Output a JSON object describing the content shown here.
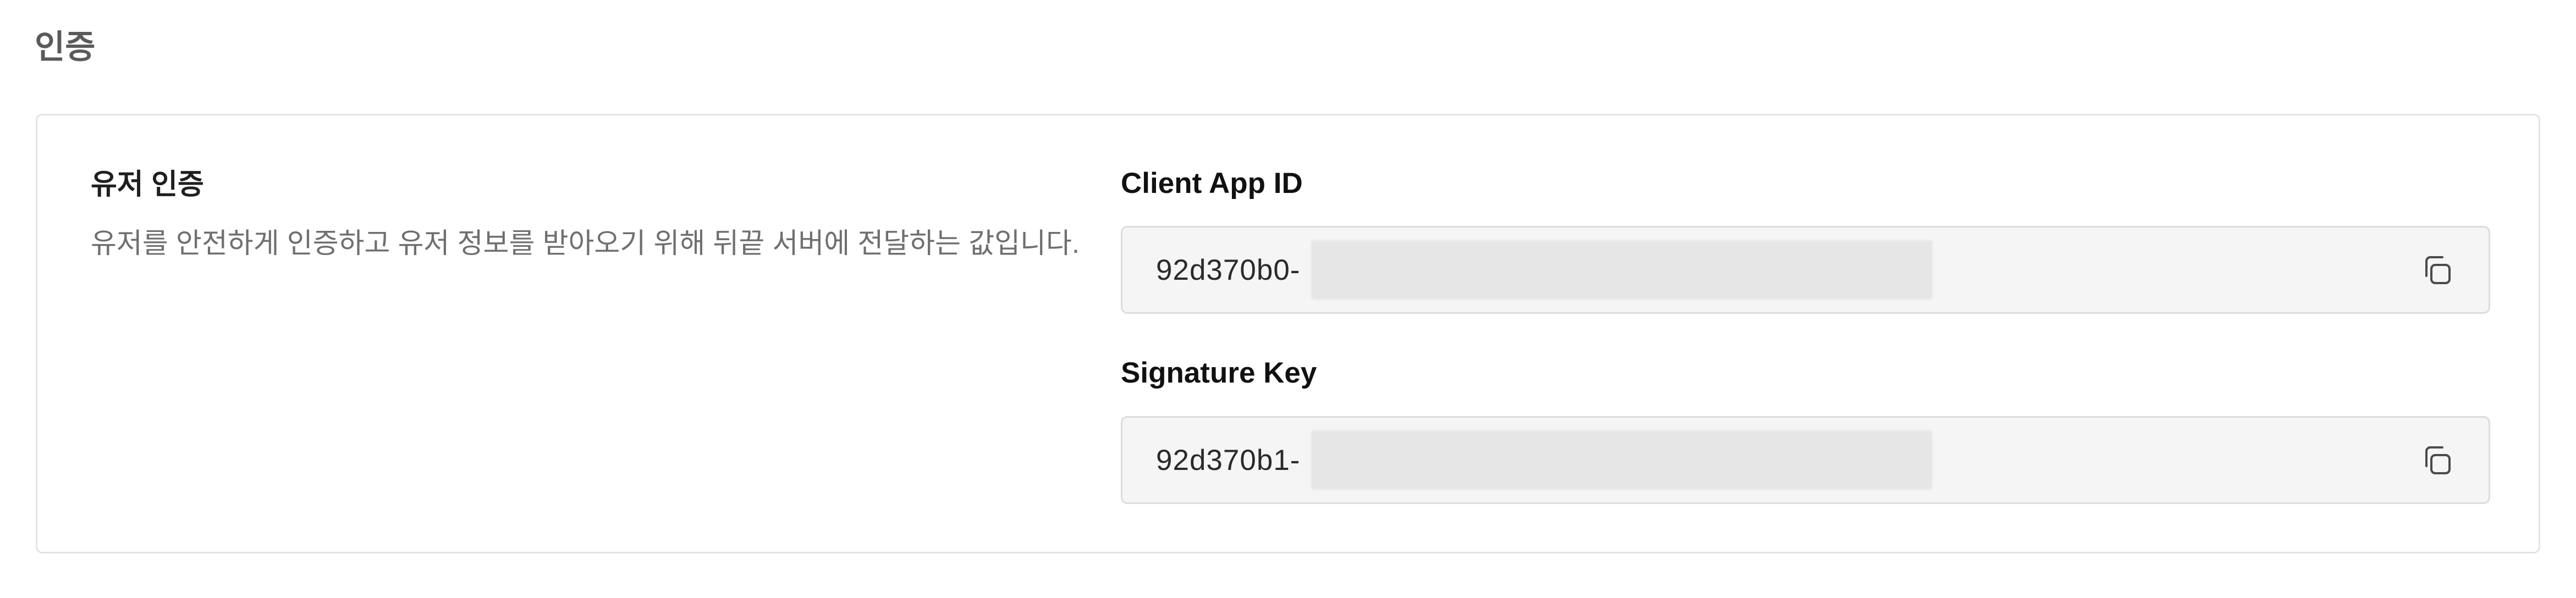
{
  "section": {
    "title": "인증"
  },
  "card": {
    "user_auth": {
      "title": "유저 인증",
      "description": "유저를 안전하게 인증하고 유저 정보를 받아오기 위해 뒤끝 서버에 전달하는 값입니다."
    },
    "client_app_id": {
      "label": "Client App ID",
      "value": "92d370b0-"
    },
    "signature_key": {
      "label": "Signature Key",
      "value": "92d370b1-"
    },
    "icons": {
      "copy": "copy-icon"
    }
  }
}
